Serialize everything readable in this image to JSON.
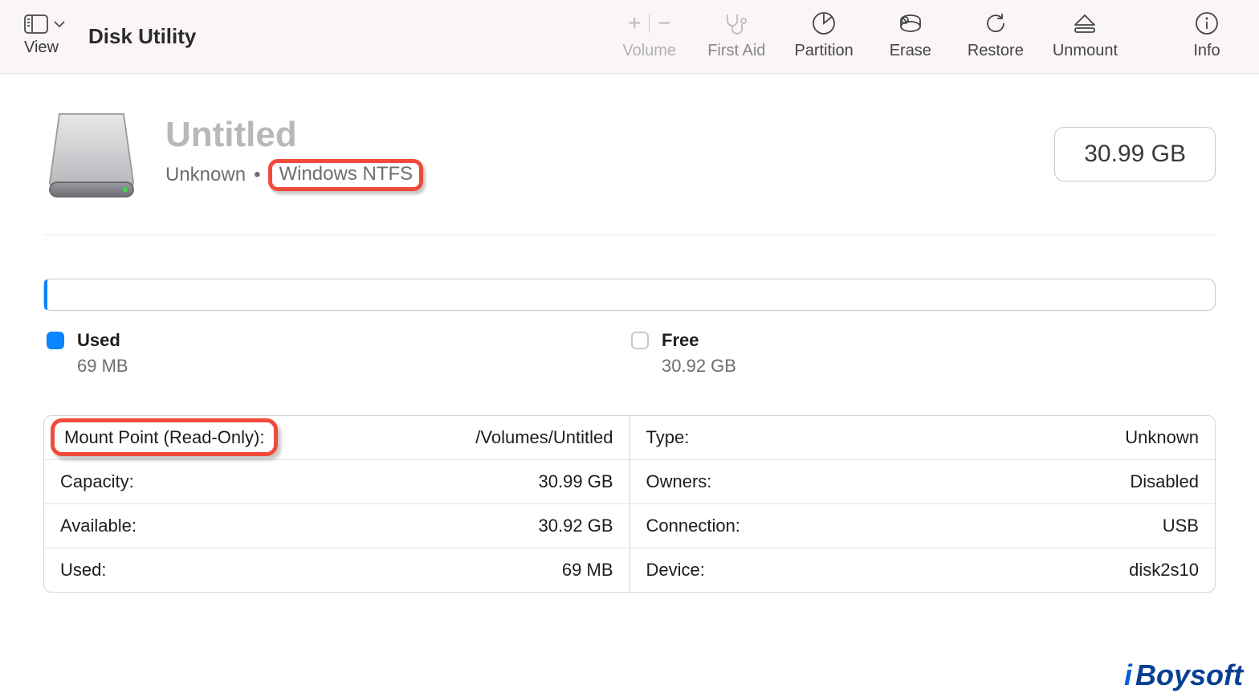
{
  "app": {
    "title": "Disk Utility"
  },
  "toolbar": {
    "view_label": "View",
    "volume_label": "Volume",
    "first_aid_label": "First Aid",
    "partition_label": "Partition",
    "erase_label": "Erase",
    "restore_label": "Restore",
    "unmount_label": "Unmount",
    "info_label": "Info"
  },
  "disk": {
    "name": "Untitled",
    "status": "Unknown",
    "fs": "Windows NTFS",
    "size": "30.99 GB"
  },
  "usage": {
    "used_label": "Used",
    "used_value": "69 MB",
    "free_label": "Free",
    "free_value": "30.92 GB"
  },
  "details": {
    "left": [
      {
        "k": "Mount Point (Read-Only):",
        "v": "/Volumes/Untitled"
      },
      {
        "k": "Capacity:",
        "v": "30.99 GB"
      },
      {
        "k": "Available:",
        "v": "30.92 GB"
      },
      {
        "k": "Used:",
        "v": "69 MB"
      }
    ],
    "right": [
      {
        "k": "Type:",
        "v": "Unknown"
      },
      {
        "k": "Owners:",
        "v": "Disabled"
      },
      {
        "k": "Connection:",
        "v": "USB"
      },
      {
        "k": "Device:",
        "v": "disk2s10"
      }
    ]
  },
  "watermark": "iBoysoft"
}
